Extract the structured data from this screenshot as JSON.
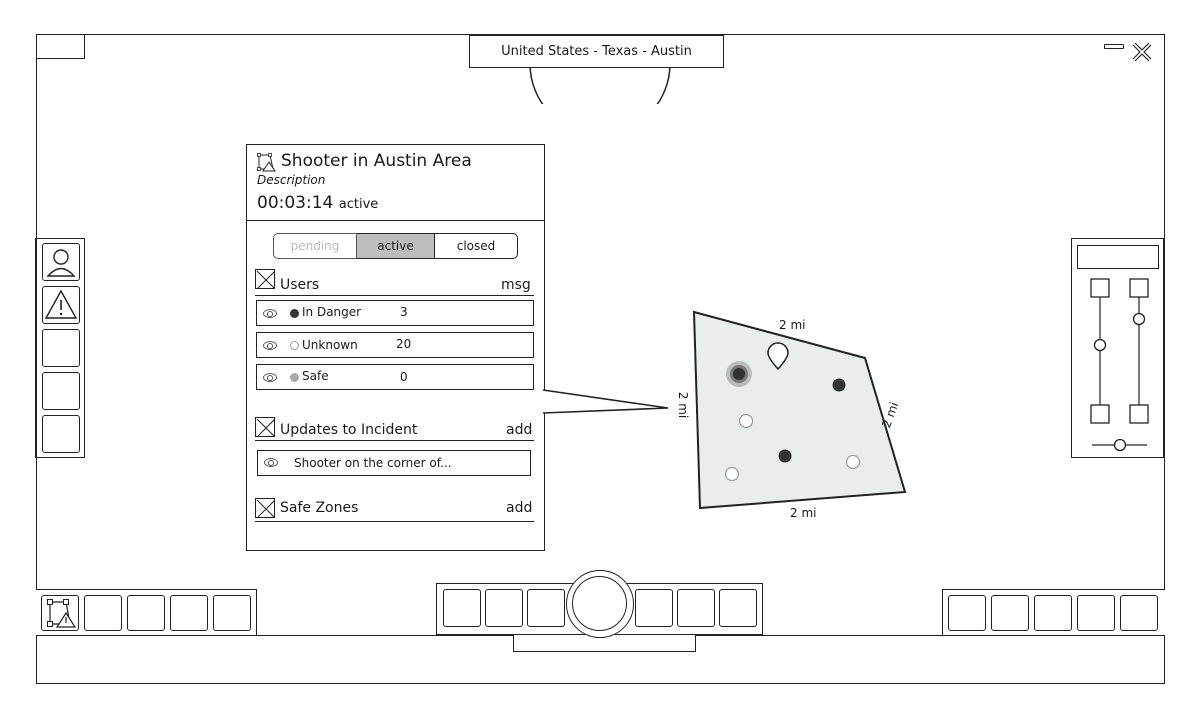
{
  "location": {
    "breadcrumb": "United States - Texas - Austin"
  },
  "window": {
    "minimize_glyph": "—",
    "close_glyph": "✕"
  },
  "incident": {
    "title": "Shooter in Austin Area",
    "description": "Description",
    "timer": "00:03:14",
    "status": "active",
    "tabs": [
      {
        "label": "pending",
        "state": "disabled"
      },
      {
        "label": "active",
        "state": "selected"
      },
      {
        "label": "closed",
        "state": "normal"
      }
    ],
    "users": {
      "label": "Users",
      "action": "msg",
      "rows": [
        {
          "label": "In Danger",
          "count": "3",
          "dot": "#333333"
        },
        {
          "label": "Unknown",
          "count": "20",
          "dot": "#ffffff"
        },
        {
          "label": "Safe",
          "count": "0",
          "dot": "#aaaaaa"
        }
      ]
    },
    "updates": {
      "label": "Updates to Incident",
      "action": "add",
      "items": [
        {
          "text": "Shooter on the corner of..."
        }
      ]
    },
    "safe_zones": {
      "label": "Safe Zones",
      "action": "add"
    }
  },
  "map": {
    "edge_labels": {
      "top": "2 mi",
      "left": "2 mi",
      "right": "2 mi",
      "bottom": "2 mi"
    },
    "zone_fill": "#e9eeec",
    "marker_colors": {
      "danger": "#333333",
      "unknown": "#ffffff",
      "highlight": "#444444"
    }
  },
  "icons": {
    "profile": "person-icon",
    "alert": "warning-icon",
    "incident": "polygon-warning-icon",
    "pin": "map-pin-icon",
    "eye": "eye-icon",
    "checkbox": "x-checkbox-icon"
  }
}
